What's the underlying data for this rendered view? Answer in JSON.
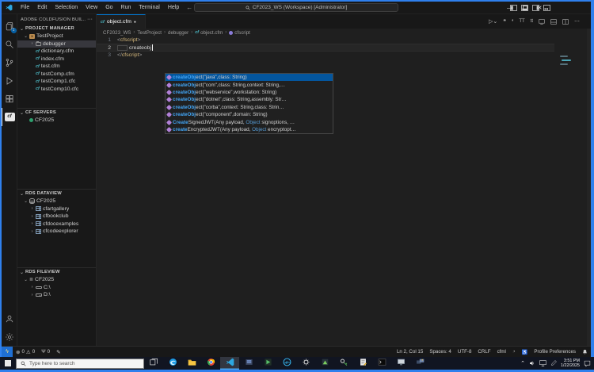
{
  "titlebar": {
    "menus": [
      "File",
      "Edit",
      "Selection",
      "View",
      "Go",
      "Run",
      "Terminal",
      "Help"
    ],
    "back_arrow": "←",
    "forward_arrow": "→",
    "search_text": "CF2023_WS (Workspace) [Administrator]",
    "minimize_glyph": "—",
    "close_glyph": "✕"
  },
  "activity_bar": {
    "items": [
      {
        "name": "explorer",
        "badge": "1"
      },
      {
        "name": "search"
      },
      {
        "name": "source-control"
      },
      {
        "name": "run-and-debug"
      },
      {
        "name": "extensions"
      },
      {
        "name": "coldfusion",
        "label": "cf",
        "active": true
      }
    ],
    "bottom_items": [
      {
        "name": "accounts"
      },
      {
        "name": "settings"
      }
    ]
  },
  "sidebar": {
    "title": "ADOBE COLDFUSION BUIL...",
    "more_actions": "···",
    "sections": [
      {
        "label": "PROJECT MANAGER",
        "items": [
          {
            "depth": 1,
            "chev": "v",
            "icon": "proj",
            "label": "TestProject"
          },
          {
            "depth": 2,
            "chev": ">",
            "icon": "folder",
            "label": "debugger",
            "selected": true
          },
          {
            "depth": 2,
            "chev": "",
            "icon": "cf",
            "label": "dictionary.cfm"
          },
          {
            "depth": 2,
            "chev": "",
            "icon": "cf",
            "label": "index.cfm"
          },
          {
            "depth": 2,
            "chev": "",
            "icon": "cf",
            "label": "test.cfm"
          },
          {
            "depth": 2,
            "chev": "",
            "icon": "cf",
            "label": "testComp.cfm"
          },
          {
            "depth": 2,
            "chev": "",
            "icon": "cf",
            "label": "testComp1.cfc"
          },
          {
            "depth": 2,
            "chev": "",
            "icon": "cf",
            "label": "testComp10.cfc"
          }
        ]
      },
      {
        "label": "CF SERVERS",
        "items": [
          {
            "depth": 1,
            "chev": "",
            "icon": "server-dot",
            "label": "CF2025"
          }
        ]
      },
      {
        "label": "RDS DATAVIEW",
        "items": [
          {
            "depth": 1,
            "chev": "v",
            "icon": "db",
            "label": "CF2025"
          },
          {
            "depth": 2,
            "chev": ">",
            "icon": "table",
            "label": "cfartgallery"
          },
          {
            "depth": 2,
            "chev": ">",
            "icon": "table",
            "label": "cfbookclub"
          },
          {
            "depth": 2,
            "chev": ">",
            "icon": "table",
            "label": "cfdocexamples"
          },
          {
            "depth": 2,
            "chev": ">",
            "icon": "table",
            "label": "cfcodeexplorer"
          }
        ]
      },
      {
        "label": "RDS FILEVIEW",
        "items": [
          {
            "depth": 1,
            "chev": "v",
            "icon": "tree",
            "label": "CF2025"
          },
          {
            "depth": 2,
            "chev": ">",
            "icon": "drive",
            "label": "C:\\"
          },
          {
            "depth": 2,
            "chev": ">",
            "icon": "drive",
            "label": "D:\\"
          }
        ]
      }
    ]
  },
  "editor": {
    "tab": {
      "label": "object.cfm",
      "dirty": "●"
    },
    "toolbar": [
      "run-cfml",
      "double-quotes",
      "single-quotes",
      "uppercase-tt",
      "lowercase-tt",
      "preview",
      "open-panel",
      "split-editor",
      "more-actions"
    ],
    "breadcrumbs": [
      {
        "label": "CF2023_WS"
      },
      {
        "label": "TestProject"
      },
      {
        "label": "debugger"
      },
      {
        "icon": "cf",
        "label": "object.cfm"
      },
      {
        "icon": "symbol",
        "label": "cfscript"
      }
    ],
    "code_lines": [
      {
        "num": "1",
        "segs": [
          [
            "<",
            "p"
          ],
          [
            "cfscript",
            "t"
          ],
          [
            ">",
            "p"
          ]
        ]
      },
      {
        "num": "2",
        "active": true,
        "indent_box": true,
        "cursor": true,
        "segs": [
          [
            "createobj",
            "w"
          ]
        ]
      },
      {
        "num": "3",
        "segs": [
          [
            "</",
            "p"
          ],
          [
            "cfscript",
            "t"
          ],
          [
            ">",
            "p"
          ]
        ]
      }
    ],
    "suggest": {
      "selected_index": 0,
      "items": [
        {
          "segs": [
            [
              "createObj",
              "m"
            ],
            [
              "ect(\"java\",class: String)",
              "w"
            ]
          ]
        },
        {
          "segs": [
            [
              "createObj",
              "m"
            ],
            [
              "ect(\"com\",class: String,context: String,…",
              "w"
            ]
          ]
        },
        {
          "segs": [
            [
              "createObj",
              "m"
            ],
            [
              "ect(\"webservice\",workstation: String)",
              "w"
            ]
          ]
        },
        {
          "segs": [
            [
              "createObj",
              "m"
            ],
            [
              "ect(\"dotnet\",class: String,assembly: Str…",
              "w"
            ]
          ]
        },
        {
          "segs": [
            [
              "createObj",
              "m"
            ],
            [
              "ect(\"corba\",context: String,class: Strin…",
              "w"
            ]
          ]
        },
        {
          "segs": [
            [
              "createObj",
              "m"
            ],
            [
              "ect(\"component\",domain: String)",
              "w"
            ]
          ]
        },
        {
          "segs": [
            [
              "Create",
              "m"
            ],
            [
              "SignedJWT(Any payload, ",
              "w"
            ],
            [
              "Object",
              "t"
            ],
            [
              " signoptions, …",
              "w"
            ]
          ]
        },
        {
          "segs": [
            [
              "create",
              "m"
            ],
            [
              "EncryptedJWT(Any payload, ",
              "w"
            ],
            [
              "Object",
              "t"
            ],
            [
              " encryptopt…",
              "w"
            ]
          ]
        }
      ]
    }
  },
  "statusbar": {
    "errors": "0",
    "warnings": "0",
    "ports": "0",
    "right_items": [
      "Ln 2, Col 15",
      "Spaces: 4",
      "UTF-8",
      "CRLF",
      "cfml"
    ],
    "profile_label": "Profile Preferences"
  },
  "taskbar": {
    "search_placeholder": "Type here to search",
    "icons": [
      {
        "name": "task-view"
      },
      {
        "name": "edge"
      },
      {
        "name": "file-explorer"
      },
      {
        "name": "chrome"
      },
      {
        "name": "vscode",
        "active": true
      },
      {
        "name": "server-app"
      },
      {
        "name": "media-app"
      },
      {
        "name": "internet-explorer"
      },
      {
        "name": "services"
      },
      {
        "name": "green-app"
      },
      {
        "name": "key-tool"
      },
      {
        "name": "editor-app"
      },
      {
        "name": "command-prompt"
      },
      {
        "name": "computer"
      },
      {
        "name": "remote-desktop"
      }
    ],
    "tray_time": "3:51 PM",
    "tray_date": "1/22/2025"
  }
}
